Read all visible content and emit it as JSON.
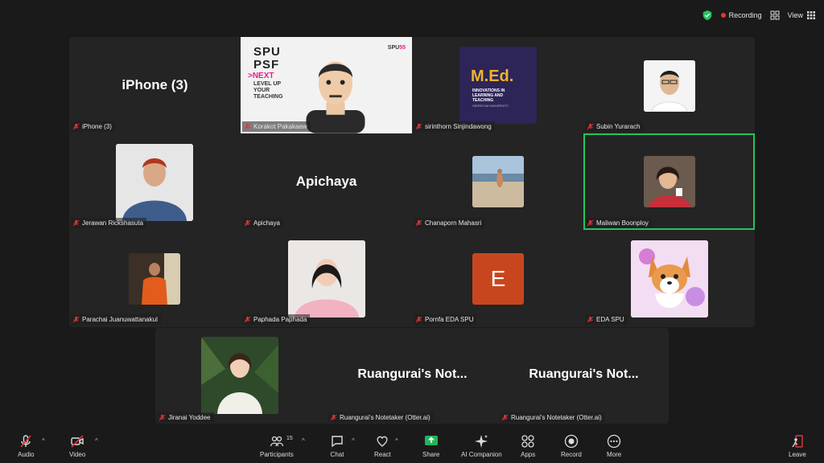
{
  "topbar": {
    "recording_label": "Recording",
    "view_label": "View"
  },
  "tiles": [
    {
      "name": "iPhone (3)",
      "big": "iPhone (3)"
    },
    {
      "name": "Korakot Pakakaew",
      "slide": {
        "lines": [
          "SPU",
          "PSF"
        ],
        "next": ">NEXT",
        "sub": [
          "LEVEL UP",
          "YOUR",
          "TEACHING"
        ],
        "logo": "SPU",
        "logo_num": "55"
      }
    },
    {
      "name": "sirinthorn Sinjindawong",
      "med": {
        "title": "M.Ed.",
        "line1": "INNOVATIONS IN",
        "line2": "LEARNING AND",
        "line3": "TEACHING",
        "line4": "SRIPATUM UNIVERSITY"
      }
    },
    {
      "name": "Subin Yurarach"
    },
    {
      "name": "Jerawan Rickshasuta"
    },
    {
      "name": "Apichaya",
      "big": "Apichaya"
    },
    {
      "name": "Chanaporn Mahasri"
    },
    {
      "name": "Maliwan Boonploy"
    },
    {
      "name": "Parachai Juanuwattanakul"
    },
    {
      "name": "Paphada Paphada"
    },
    {
      "name": "Pornfa EDA SPU",
      "initial": "E"
    },
    {
      "name": "EDA SPU"
    },
    {
      "name": "Jiranai Yoddee"
    },
    {
      "name": "Ruangurai's Notetaker (Otter.ai)",
      "big": "Ruangurai's Not..."
    },
    {
      "name": "Ruangurai's Notetaker (Otter.ai)",
      "big": "Ruangurai's Not..."
    }
  ],
  "toolbar": {
    "audio": "Audio",
    "video": "Video",
    "participants": "Participants",
    "participants_count": "15",
    "chat": "Chat",
    "react": "React",
    "share": "Share",
    "ai": "AI Companion",
    "apps": "Apps",
    "record": "Record",
    "more": "More",
    "leave": "Leave"
  },
  "colors": {
    "active_border": "#22c55e",
    "share_green": "#24b35a",
    "tile_bg": "#242424",
    "mute_red": "#e5343a",
    "initial_bg": "#c8461e"
  }
}
